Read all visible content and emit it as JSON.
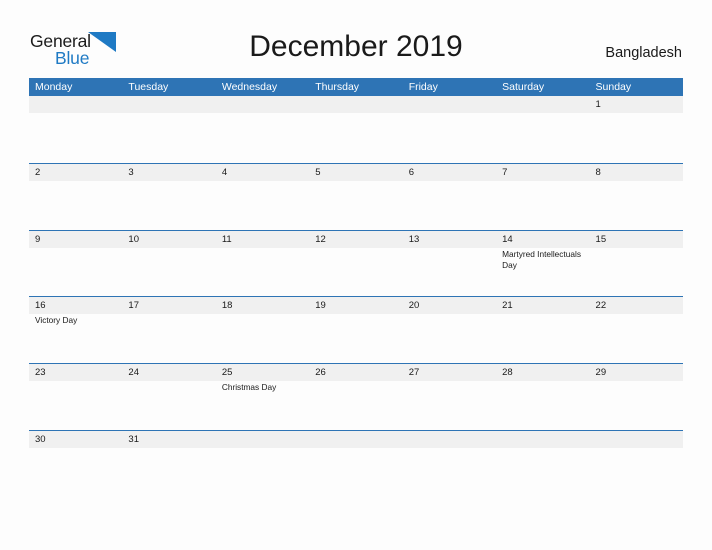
{
  "brand": {
    "name_part1": "General",
    "name_part2": "Blue",
    "flag_icon": "blue-triangle-flag-icon",
    "color_dark": "#1b1b1b",
    "color_blue": "#1f7ac4"
  },
  "header": {
    "title": "December 2019",
    "country": "Bangladesh"
  },
  "calendar": {
    "header_bg": "#2e74b5",
    "numband_bg": "#f0f0f0",
    "row_border": "#2e74b5",
    "weekday_headers": [
      "Monday",
      "Tuesday",
      "Wednesday",
      "Thursday",
      "Friday",
      "Saturday",
      "Sunday"
    ],
    "weeks": [
      [
        {
          "day": "",
          "event": ""
        },
        {
          "day": "",
          "event": ""
        },
        {
          "day": "",
          "event": ""
        },
        {
          "day": "",
          "event": ""
        },
        {
          "day": "",
          "event": ""
        },
        {
          "day": "",
          "event": ""
        },
        {
          "day": "1",
          "event": ""
        }
      ],
      [
        {
          "day": "2",
          "event": ""
        },
        {
          "day": "3",
          "event": ""
        },
        {
          "day": "4",
          "event": ""
        },
        {
          "day": "5",
          "event": ""
        },
        {
          "day": "6",
          "event": ""
        },
        {
          "day": "7",
          "event": ""
        },
        {
          "day": "8",
          "event": ""
        }
      ],
      [
        {
          "day": "9",
          "event": ""
        },
        {
          "day": "10",
          "event": ""
        },
        {
          "day": "11",
          "event": ""
        },
        {
          "day": "12",
          "event": ""
        },
        {
          "day": "13",
          "event": ""
        },
        {
          "day": "14",
          "event": "Martyred Intellectuals Day"
        },
        {
          "day": "15",
          "event": ""
        }
      ],
      [
        {
          "day": "16",
          "event": "Victory Day"
        },
        {
          "day": "17",
          "event": ""
        },
        {
          "day": "18",
          "event": ""
        },
        {
          "day": "19",
          "event": ""
        },
        {
          "day": "20",
          "event": ""
        },
        {
          "day": "21",
          "event": ""
        },
        {
          "day": "22",
          "event": ""
        }
      ],
      [
        {
          "day": "23",
          "event": ""
        },
        {
          "day": "24",
          "event": ""
        },
        {
          "day": "25",
          "event": "Christmas Day"
        },
        {
          "day": "26",
          "event": ""
        },
        {
          "day": "27",
          "event": ""
        },
        {
          "day": "28",
          "event": ""
        },
        {
          "day": "29",
          "event": ""
        }
      ],
      [
        {
          "day": "30",
          "event": ""
        },
        {
          "day": "31",
          "event": ""
        },
        {
          "day": "",
          "event": ""
        },
        {
          "day": "",
          "event": ""
        },
        {
          "day": "",
          "event": ""
        },
        {
          "day": "",
          "event": ""
        },
        {
          "day": "",
          "event": ""
        }
      ]
    ]
  }
}
